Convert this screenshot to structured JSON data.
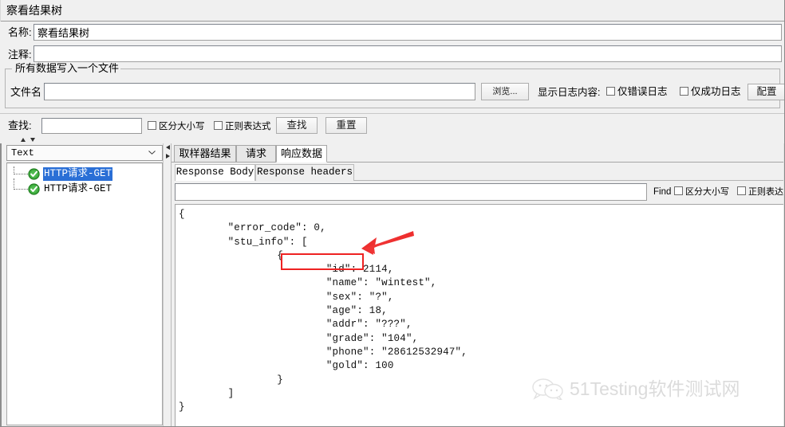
{
  "window": {
    "title": "察看结果树"
  },
  "form": {
    "name_label": "名称:",
    "name_value": "察看结果树",
    "comment_label": "注释:",
    "comment_value": ""
  },
  "file_group": {
    "legend": "所有数据写入一个文件",
    "filename_label": "文件名",
    "filename_value": "",
    "browse_button": "浏览...",
    "log_content_label": "显示日志内容:",
    "errors_only_label": "仅错误日志",
    "errors_only_checked": false,
    "success_only_label": "仅成功日志",
    "success_only_checked": false,
    "configure_button": "配置"
  },
  "search_bar": {
    "label": "查找:",
    "value": "",
    "case_sensitive_label": "区分大小写",
    "case_sensitive_checked": false,
    "regex_label": "正则表达式",
    "regex_checked": false,
    "find_button": "查找",
    "reset_button": "重置"
  },
  "left_pane": {
    "render_select_value": "Text",
    "tree_items": [
      {
        "label": "HTTP请求-GET",
        "status": "success",
        "selected": true
      },
      {
        "label": "HTTP请求-GET",
        "status": "success",
        "selected": false
      }
    ]
  },
  "right_pane": {
    "tabs": [
      {
        "label": "取样器结果",
        "active": false
      },
      {
        "label": "请求",
        "active": false
      },
      {
        "label": "响应数据",
        "active": true
      }
    ],
    "sub_tabs": [
      {
        "label": "Response Body",
        "active": true
      },
      {
        "label": "Response headers",
        "active": false
      }
    ],
    "find": {
      "value": "",
      "label": "Find",
      "case_sensitive_label": "区分大小写",
      "case_sensitive_checked": false,
      "regex_label": "正则表达式",
      "regex_checked": false
    },
    "response_body": "{\n        \"error_code\": 0,\n        \"stu_info\": [\n                {\n                        \"id\": 2114,\n                        \"name\": \"wintest\",\n                        \"sex\": \"?\",\n                        \"age\": 18,\n                        \"addr\": \"???\",\n                        \"grade\": \"104\",\n                        \"phone\": \"28612532947\",\n                        \"gold\": 100\n                }\n        ]\n}"
  },
  "annotation": {
    "highlight_text": "\"id\": 2114,",
    "highlight_color": "#ee2222",
    "arrow_color": "#ee2222"
  },
  "watermark": {
    "text": "51Testing软件测试网",
    "color": "#d9d9d9"
  },
  "colors": {
    "window_bg": "#f0f0f0",
    "panel_bg": "#ffffff",
    "selection_blue": "#2a6fd6",
    "status_green": "#39b54a"
  }
}
